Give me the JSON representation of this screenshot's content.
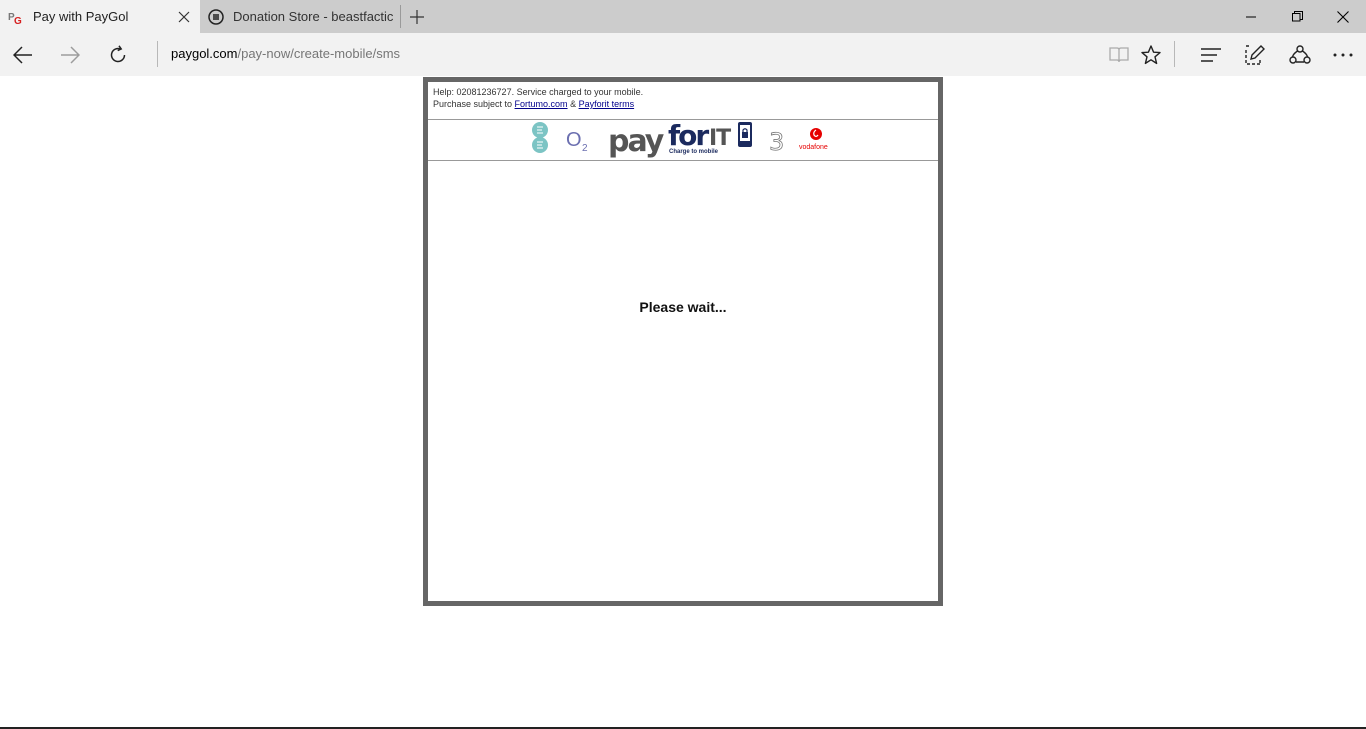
{
  "tabs": [
    {
      "title": "Pay with PayGol",
      "active": true
    },
    {
      "title": "Donation Store - beastfactic",
      "active": false
    }
  ],
  "address": {
    "domain": "paygol.com",
    "path": "/pay-now/create-mobile/sms"
  },
  "page": {
    "help_prefix": "Help: 02081236727. Service charged to your mobile.",
    "purchase_prefix": "Purchase subject to ",
    "link_fortumo": "Fortumo.com",
    "amp": " & ",
    "link_payforit": "Payforit terms",
    "logo_o2": "O",
    "logo_o2_sub": "2",
    "logo_payforit_pay": "pay",
    "logo_payforit_for": "for",
    "logo_payforit_it": "IT",
    "logo_payforit_tagline": "Charge to mobile",
    "logo_three": "3",
    "logo_vodafone": "vodafone",
    "status": "Please wait..."
  },
  "colors": {
    "ee": "#7cc4c4",
    "o2": "#6b6fb0",
    "payforit_grey": "#555555",
    "payforit_navy": "#1b2a5e",
    "vodafone": "#e60000"
  }
}
